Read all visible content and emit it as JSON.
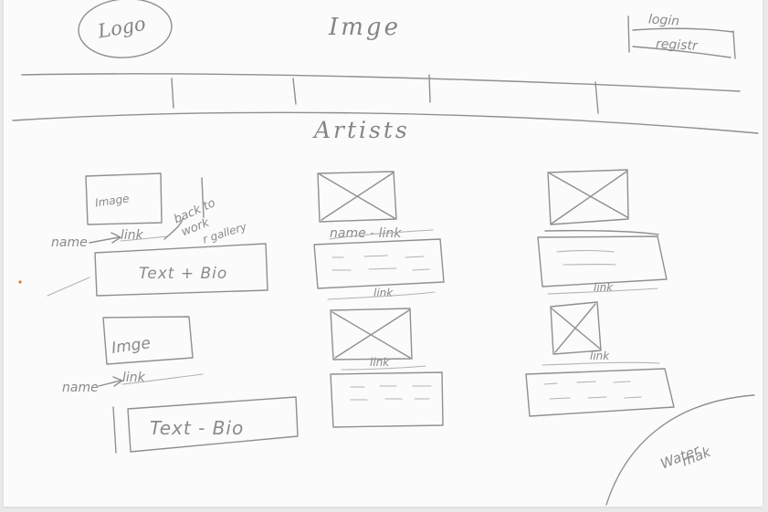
{
  "header": {
    "logo_label": "Logo",
    "image_label": "Imge",
    "login_label": "login",
    "register_label": "registr"
  },
  "section_title": "Artists",
  "artists": {
    "first": {
      "image_label": "Image",
      "name_label": "name",
      "link_label": "link",
      "note_line1": "back to",
      "note_line2": "work",
      "note_line3": "r gallery",
      "bio_label": "Text + Bio"
    },
    "second": {
      "image_label": "Imge",
      "name_label": "name",
      "link_label": "link",
      "bio_label": "Text - Bio"
    }
  },
  "gallery": {
    "caption_top": "name - link",
    "links": [
      "link",
      "link",
      "link",
      "link"
    ]
  },
  "watermark": {
    "line1": "Water",
    "line2": "mak"
  }
}
